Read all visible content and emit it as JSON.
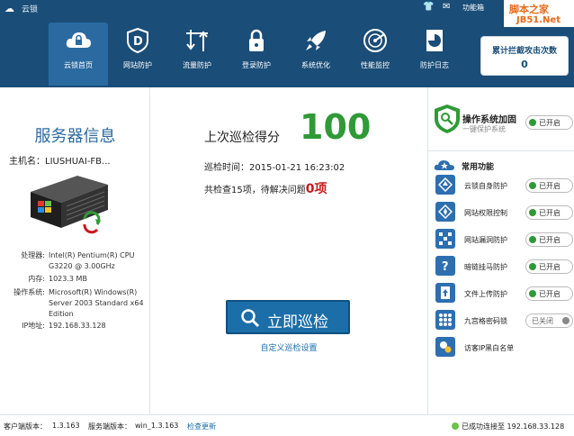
{
  "app": {
    "title": "云锁"
  },
  "toolbar": {
    "toolbox_label": "功能箱"
  },
  "watermark": {
    "line1": "脚本之家",
    "line2": "JB51.Net"
  },
  "nav": [
    {
      "label": "云锁首页",
      "icon": "cloud-lock-icon",
      "active": true
    },
    {
      "label": "网站防护",
      "icon": "shield-d-icon",
      "active": false
    },
    {
      "label": "流量防护",
      "icon": "traffic-arrows-icon",
      "active": false
    },
    {
      "label": "登录防护",
      "icon": "padlock-icon",
      "active": false
    },
    {
      "label": "系统优化",
      "icon": "rocket-icon",
      "active": false
    },
    {
      "label": "性能监控",
      "icon": "radar-icon",
      "active": false
    },
    {
      "label": "防护日志",
      "icon": "log-chart-icon",
      "active": false
    }
  ],
  "counter": {
    "label": "累计拦截攻击次数",
    "value": "0"
  },
  "server": {
    "title": "服务器信息",
    "host_label": "主机名：",
    "host_value": "LIUSHUAI-FB...",
    "specs": [
      {
        "key": "处理器:",
        "value": "Intel(R) Pentium(R) CPU G3220 @ 3.00GHz"
      },
      {
        "key": "内存:",
        "value": "1023.3 MB"
      },
      {
        "key": "操作系统:",
        "value": "Microsoft(R) Windows(R) Server 2003 Standard x64 Edition"
      },
      {
        "key": "IP地址:",
        "value": "192.168.33.128"
      }
    ]
  },
  "scan": {
    "last_score_label": "上次巡检得分",
    "score": "100",
    "time_label": "巡检时间：",
    "time_value": "2015-01-21 16:23:02",
    "summary_prefix": "共检查15项，待解决问题",
    "problems": "0项",
    "button_label": "立即巡检",
    "custom_link": "自定义巡检设置"
  },
  "os_hardening": {
    "title": "操作系统加固",
    "subtitle": "一键保护系统",
    "toggle": "已开启"
  },
  "common": {
    "title": "常用功能",
    "items": [
      {
        "label": "云锁自身防护",
        "toggle": "已开启",
        "on": true,
        "icon": "self-protect-icon"
      },
      {
        "label": "网站权限控制",
        "toggle": "已开启",
        "on": true,
        "icon": "permission-icon"
      },
      {
        "label": "网站漏洞防护",
        "toggle": "已开启",
        "on": true,
        "icon": "vulnerability-icon"
      },
      {
        "label": "暗链挂马防护",
        "toggle": "已开启",
        "on": true,
        "icon": "darklink-icon"
      },
      {
        "label": "文件上传防护",
        "toggle": "已开启",
        "on": true,
        "icon": "upload-icon"
      },
      {
        "label": "九宫格密码锁",
        "toggle": "已关闭",
        "on": false,
        "icon": "grid-lock-icon"
      },
      {
        "label": "访客IP黑白名单",
        "toggle": "",
        "on": null,
        "icon": "ip-list-icon"
      }
    ]
  },
  "status": {
    "client_version_label": "客户端版本：",
    "client_version": "1.3.163",
    "server_version_label": "服务端版本：",
    "server_version": "win_1.3.163",
    "check_update": "检查更新",
    "connected": "已成功连接至 192.168.33.128"
  }
}
